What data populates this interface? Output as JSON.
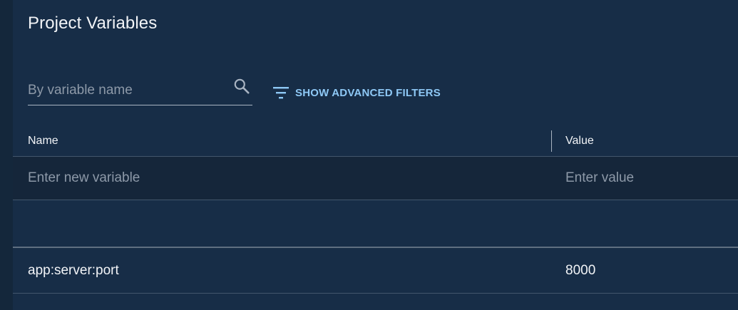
{
  "page": {
    "title": "Project Variables"
  },
  "search": {
    "placeholder": "By variable name",
    "value": "",
    "icon": "search-icon"
  },
  "filters": {
    "label": "SHOW ADVANCED FILTERS",
    "icon": "filter-list-icon",
    "color": "#8ec8f5"
  },
  "table": {
    "columns": [
      "Name",
      "Value"
    ],
    "new_row": {
      "name_placeholder": "Enter new variable",
      "value_placeholder": "Enter value"
    },
    "rows": [
      {
        "name": "app:server:port",
        "value": "8000"
      }
    ]
  },
  "colors": {
    "background": "#172d47",
    "text": "#f2f4f7",
    "placeholder": "#8d99a8",
    "accent": "#8ec8f5"
  }
}
